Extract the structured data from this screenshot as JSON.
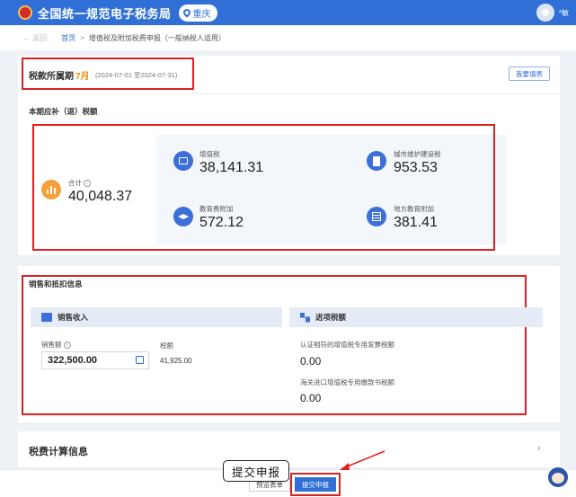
{
  "header": {
    "title": "全国统一规范电子税务局",
    "region": "重庆",
    "user_initial": "*敏"
  },
  "breadcrumb": {
    "back": "返回",
    "home": "首页",
    "separator": ">",
    "current": "增值税及附加税费申报（一般纳税人适用）"
  },
  "period": {
    "label": "税款所属期",
    "month": "7月",
    "range": "(2024-07-01 至2024-07-31)",
    "correct_button": "我要填表"
  },
  "tax_summary": {
    "title": "本期应补（退）税额",
    "total": {
      "label": "合计",
      "value": "40,048.37"
    },
    "items": [
      {
        "label": "增值税",
        "value": "38,141.31",
        "icon": "invoice-icon"
      },
      {
        "label": "城市维护建设税",
        "value": "953.53",
        "icon": "building-icon"
      },
      {
        "label": "教育费附加",
        "value": "572.12",
        "icon": "graduation-cap-icon"
      },
      {
        "label": "地方教育附加",
        "value": "381.41",
        "icon": "ledger-icon"
      }
    ]
  },
  "sales": {
    "title": "销售和抵扣信息",
    "revenue": {
      "header": "销售收入",
      "amount_label": "销售额",
      "amount_value": "322,500.00",
      "tax_label": "税额",
      "tax_value": "41,925.00"
    },
    "input_tax": {
      "header": "进项税额",
      "cert_label": "认证相符的增值税专用发票税额",
      "cert_value": "0.00",
      "customs_label": "海关进口增值税专用缴款书税额",
      "customs_value": "0.00"
    }
  },
  "calc": {
    "title": "税费计算信息"
  },
  "footer": {
    "preview_button": "预览表单",
    "submit_button": "提交申报",
    "callout": "提交申报"
  },
  "colors": {
    "brand": "#2f6fd6",
    "highlight": "#e02020",
    "accent": "#f08c00"
  }
}
